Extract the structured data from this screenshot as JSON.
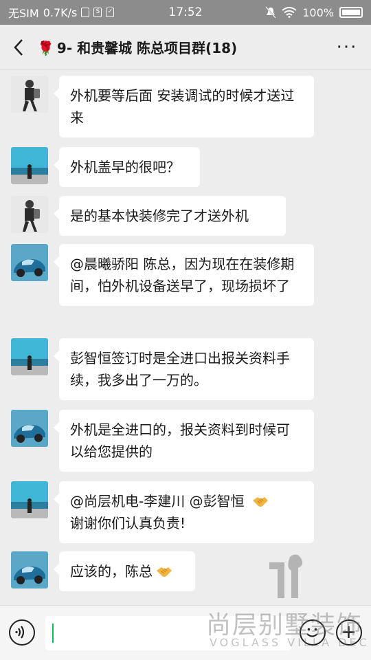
{
  "status_bar": {
    "carrier": "无SIM",
    "speed": "0.7K/s",
    "time": "17:52",
    "battery": "100%"
  },
  "header": {
    "back_icon": "chevron-left-icon",
    "title_emoji": "🌹",
    "title": "9- 和贵馨城 陈总项目群(18)",
    "more_label": "···"
  },
  "messages": [
    {
      "sender_avatar": "person-backpack-avatar",
      "text": "外机要等后面 安装调试的时候才送过来"
    },
    {
      "sender_avatar": "seaside-avatar",
      "text": "外机盖早的很吧？"
    },
    {
      "sender_avatar": "person-backpack-avatar",
      "text": "是的基本快装修完了才送外机"
    },
    {
      "sender_avatar": "blue-car-avatar",
      "text": "@晨曦骄阳  陈总，因为现在在装修期间，怕外机设备送早了，现场损坏了"
    },
    {
      "sender_avatar": "seaside-avatar",
      "text": "彭智恒签订时是全进口出报关资料手续，我多出了一万的。"
    },
    {
      "sender_avatar": "blue-car-avatar",
      "text": "外机是全进口的，报关资料到时候可以给您提供的"
    },
    {
      "sender_avatar": "seaside-avatar",
      "text_line1": "@尚层机电-李建川 @彭智恒",
      "text_line2": "谢谢你们认真负责!",
      "emoji": "handshake-emoji"
    },
    {
      "sender_avatar": "blue-car-avatar",
      "text": "应该的，陈总",
      "emoji": "handshake-emoji"
    }
  ],
  "input": {
    "placeholder": "",
    "voice_icon": "voice-icon",
    "emoji_icon": "smiley-icon",
    "plus_icon": "plus-icon"
  },
  "watermark": {
    "chinese": "尚层别墅装饰",
    "english": "VOGLASS VILLA DEC"
  }
}
